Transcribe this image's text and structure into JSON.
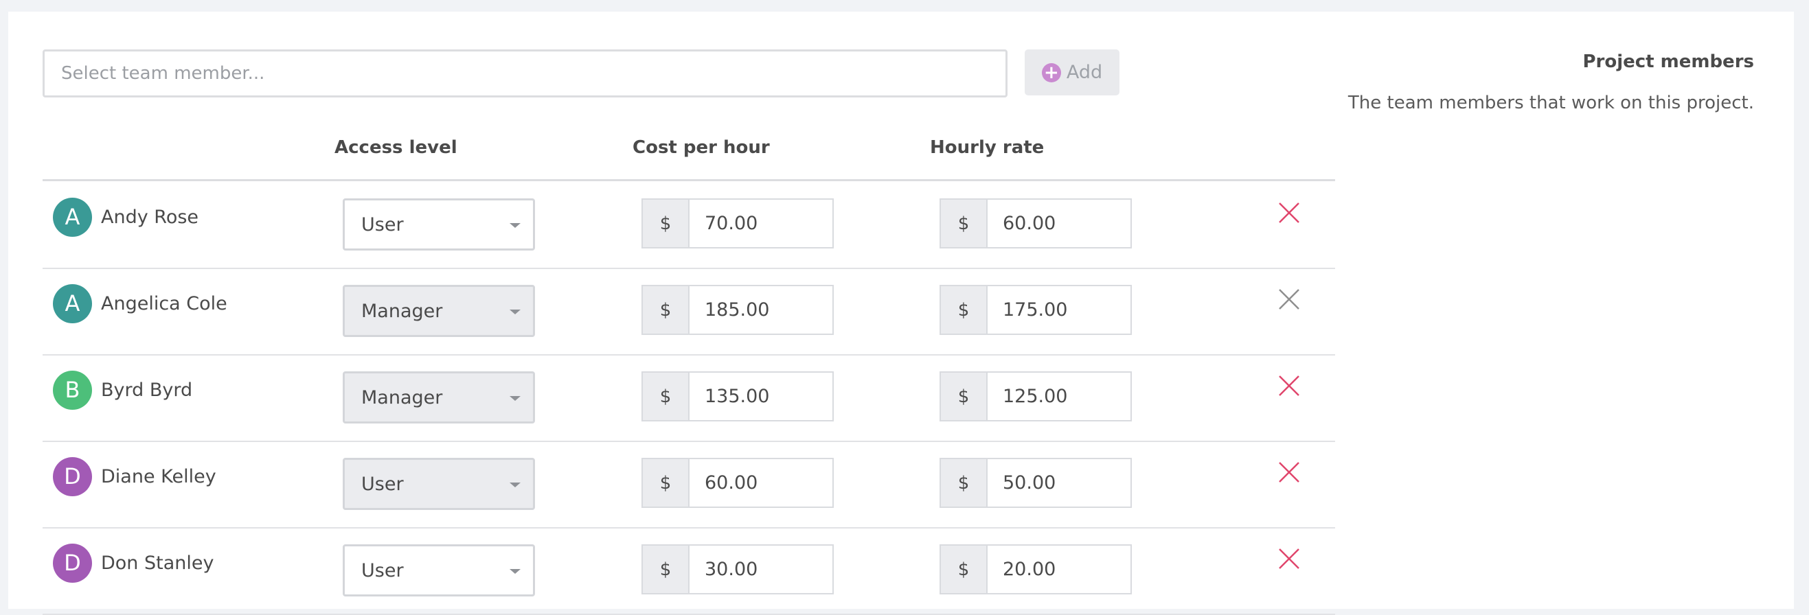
{
  "search": {
    "placeholder": "Select team member..."
  },
  "add_button": {
    "label": "Add"
  },
  "sidebar": {
    "title": "Project members",
    "description": "The team members that work on this project."
  },
  "columns": {
    "access_level": "Access level",
    "cost_per_hour": "Cost per hour",
    "hourly_rate": "Hourly rate"
  },
  "currency_symbol": "$",
  "colors": {
    "teal": "#3a9a96",
    "green": "#4dbf7a",
    "purple": "#a25ab5",
    "remove_active": "#e0456b",
    "remove_muted": "#8e8e8e"
  },
  "members": [
    {
      "initial": "A",
      "name": "Andy Rose",
      "access": "User",
      "cost": "70.00",
      "rate": "60.00",
      "avatar_color": "teal",
      "select_style": "white",
      "remove_color": "remove_active"
    },
    {
      "initial": "A",
      "name": "Angelica Cole",
      "access": "Manager",
      "cost": "185.00",
      "rate": "175.00",
      "avatar_color": "teal",
      "select_style": "grey",
      "remove_color": "remove_muted"
    },
    {
      "initial": "B",
      "name": "Byrd Byrd",
      "access": "Manager",
      "cost": "135.00",
      "rate": "125.00",
      "avatar_color": "green",
      "select_style": "grey",
      "remove_color": "remove_active"
    },
    {
      "initial": "D",
      "name": "Diane Kelley",
      "access": "User",
      "cost": "60.00",
      "rate": "50.00",
      "avatar_color": "purple",
      "select_style": "grey",
      "remove_color": "remove_active"
    },
    {
      "initial": "D",
      "name": "Don Stanley",
      "access": "User",
      "cost": "30.00",
      "rate": "20.00",
      "avatar_color": "purple",
      "select_style": "white",
      "remove_color": "remove_active"
    }
  ]
}
